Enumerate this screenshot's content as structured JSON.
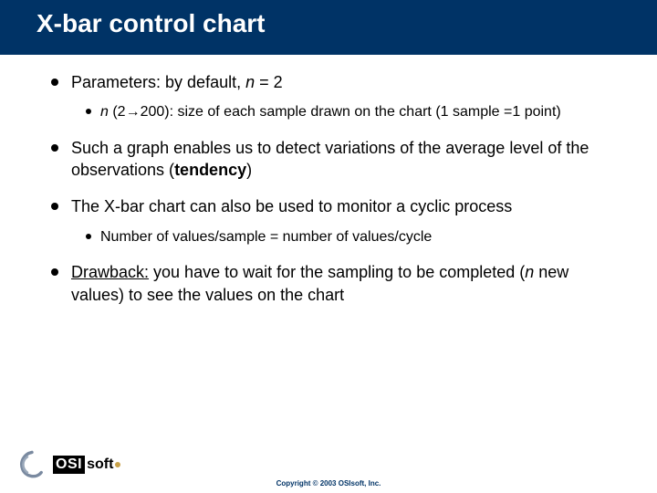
{
  "title": "X-bar control chart",
  "bullets": {
    "b1_prefix": "Parameters: by default, ",
    "b1_var": "n",
    "b1_suffix": " = 2",
    "b1a_var": "n",
    "b1a_range_open": " (2",
    "b1a_arrow": "→",
    "b1a_range_close": "200):",
    "b1a_rest": " size of each sample drawn on the chart (1 sample =1 point)",
    "b2_pre": "Such a graph enables us to detect variations of the average level of the observations (",
    "b2_bold": "tendency",
    "b2_post": ")",
    "b3": "The X-bar chart can also be used to monitor a cyclic process",
    "b3a": "Number of values/sample = number of values/cycle",
    "b4_uline": "Drawback:",
    "b4_mid": " you have to wait for the sampling to be completed (",
    "b4_var": "n",
    "b4_end": " new values) to see the values on the chart"
  },
  "logo": {
    "osi": "OSI",
    "soft": "soft"
  },
  "copyright": "Copyright © 2003 OSIsoft, Inc."
}
